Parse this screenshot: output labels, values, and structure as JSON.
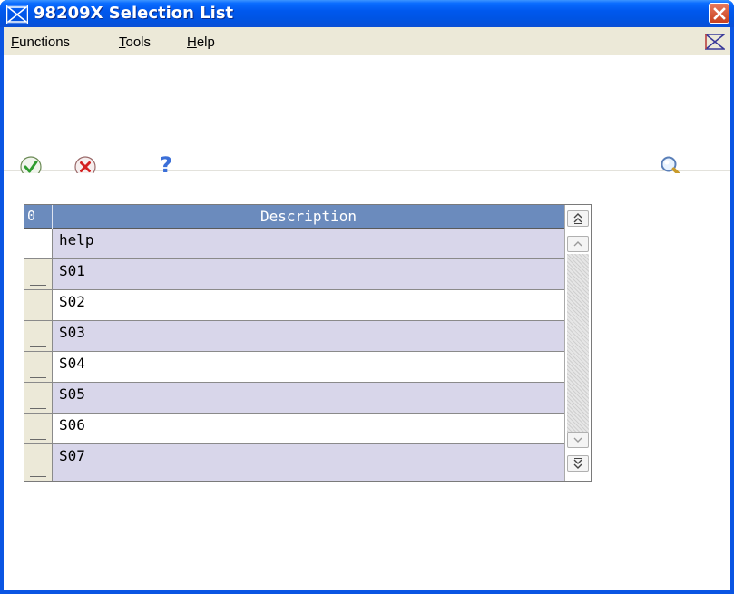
{
  "window": {
    "title": "98209X  Selection List"
  },
  "menu": {
    "items": [
      {
        "label": "Functions",
        "accel": "F"
      },
      {
        "label": "Tools",
        "accel": "T"
      },
      {
        "label": "Help",
        "accel": "H"
      }
    ]
  },
  "toolbar": {
    "ok_icon": "checkmark-icon",
    "cancel_icon": "x-circle-icon",
    "help_icon": "question-mark-icon",
    "find_icon": "magnifier-icon",
    "help_label": "?"
  },
  "grid": {
    "columns": [
      {
        "header": "0"
      },
      {
        "header": "Description"
      }
    ],
    "rows": [
      {
        "description": "help"
      },
      {
        "description": "S01"
      },
      {
        "description": "S02"
      },
      {
        "description": "S03"
      },
      {
        "description": "S04"
      },
      {
        "description": "S05"
      },
      {
        "description": "S06"
      },
      {
        "description": "S07"
      }
    ]
  },
  "colors": {
    "title_bar": "#0054e3",
    "grid_header": "#6b8bbd",
    "row_alt": "#d8d6ea"
  }
}
